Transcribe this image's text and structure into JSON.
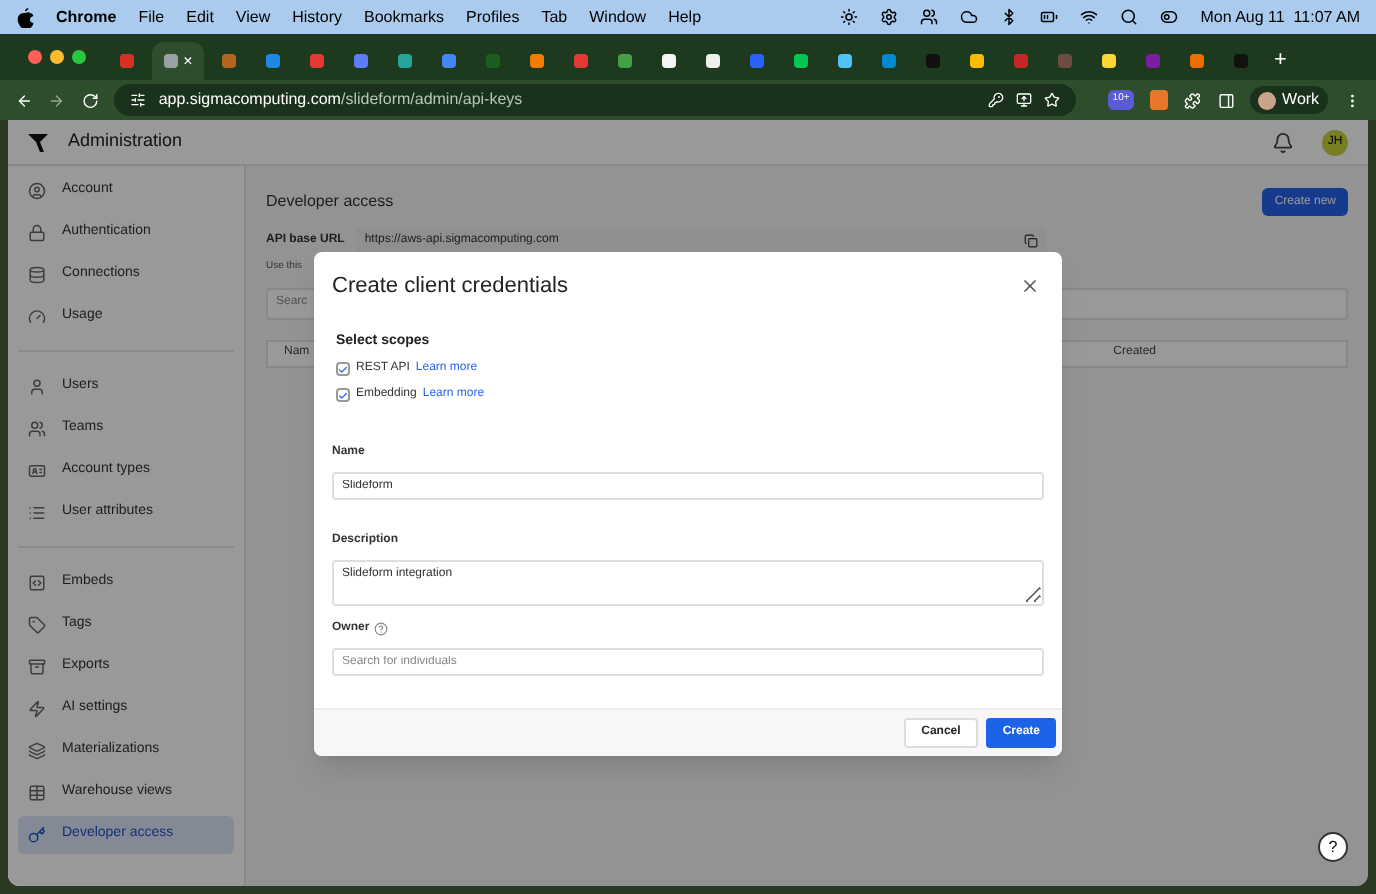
{
  "menubar": {
    "app": "Chrome",
    "menus": [
      "File",
      "Edit",
      "View",
      "History",
      "Bookmarks",
      "Profiles",
      "Tab",
      "Window",
      "Help"
    ],
    "clock": "Mon Aug 11  11:07 AM"
  },
  "browser": {
    "tabs": [
      {
        "color": "#d93025",
        "selected": false
      },
      {
        "color": "#9aa0a6",
        "selected": true,
        "close": "×"
      },
      {
        "color": "#b5651d",
        "selected": false
      },
      {
        "color": "#1e88e5",
        "selected": false
      },
      {
        "color": "#e53935",
        "selected": false
      },
      {
        "color": "#5c7cfa",
        "selected": false
      },
      {
        "color": "#26a69a",
        "selected": false
      },
      {
        "color": "#4285f4",
        "selected": false
      },
      {
        "color": "#1b5e20",
        "selected": false
      },
      {
        "color": "#f57c00",
        "selected": false
      },
      {
        "color": "#e53935",
        "selected": false
      },
      {
        "color": "#43a047",
        "selected": false
      },
      {
        "color": "#f5f5f5",
        "selected": false
      },
      {
        "color": "#eeeeee",
        "selected": false
      },
      {
        "color": "#2962ff",
        "selected": false
      },
      {
        "color": "#00c853",
        "selected": false
      },
      {
        "color": "#4fc3f7",
        "selected": false
      },
      {
        "color": "#0288d1",
        "selected": false
      },
      {
        "color": "#111111",
        "selected": false
      },
      {
        "color": "#fbbc04",
        "selected": false
      },
      {
        "color": "#c62828",
        "selected": false
      },
      {
        "color": "#6d4c41",
        "selected": false
      },
      {
        "color": "#fdd835",
        "selected": false
      },
      {
        "color": "#7b1fa2",
        "selected": false
      },
      {
        "color": "#ef6c00",
        "selected": false
      },
      {
        "color": "#111111",
        "selected": false
      }
    ],
    "new_tab": "+",
    "url_host": "app.sigmacomputing.com",
    "url_path": "/slideform/admin/api-keys",
    "extension_badge": "10+",
    "profile": "Work"
  },
  "header": {
    "title": "Administration",
    "avatar": "JH"
  },
  "sidebar": {
    "groups": [
      [
        {
          "label": "Account",
          "selected": false
        },
        {
          "label": "Authentication",
          "selected": false
        },
        {
          "label": "Connections",
          "selected": false
        },
        {
          "label": "Usage",
          "selected": false
        }
      ],
      [
        {
          "label": "Users",
          "selected": false
        },
        {
          "label": "Teams",
          "selected": false
        },
        {
          "label": "Account types",
          "selected": false
        },
        {
          "label": "User attributes",
          "selected": false
        }
      ],
      [
        {
          "label": "Embeds",
          "selected": false
        },
        {
          "label": "Tags",
          "selected": false
        },
        {
          "label": "Exports",
          "selected": false
        },
        {
          "label": "AI settings",
          "selected": false
        },
        {
          "label": "Materializations",
          "selected": false
        },
        {
          "label": "Warehouse views",
          "selected": false
        },
        {
          "label": "Developer access",
          "selected": true
        }
      ]
    ]
  },
  "page": {
    "title": "Developer access",
    "create_button": "Create new",
    "api_label": "API base URL",
    "api_url": "https://aws-api.sigmacomputing.com",
    "hint": "Use this",
    "search_placeholder": "Searc",
    "table": {
      "columns": [
        "Nam",
        "Created"
      ]
    }
  },
  "dialog": {
    "title": "Create client credentials",
    "scopes_heading": "Select scopes",
    "scopes": [
      {
        "label": "REST API",
        "link": "Learn more",
        "checked": true
      },
      {
        "label": "Embedding",
        "link": "Learn more",
        "checked": true
      }
    ],
    "name": {
      "label": "Name",
      "value": "Slideform"
    },
    "description": {
      "label": "Description",
      "value": "Slideform integration"
    },
    "owner": {
      "label": "Owner",
      "placeholder": "Search for individuals"
    },
    "buttons": {
      "cancel": "Cancel",
      "create": "Create"
    }
  },
  "help": "?"
}
